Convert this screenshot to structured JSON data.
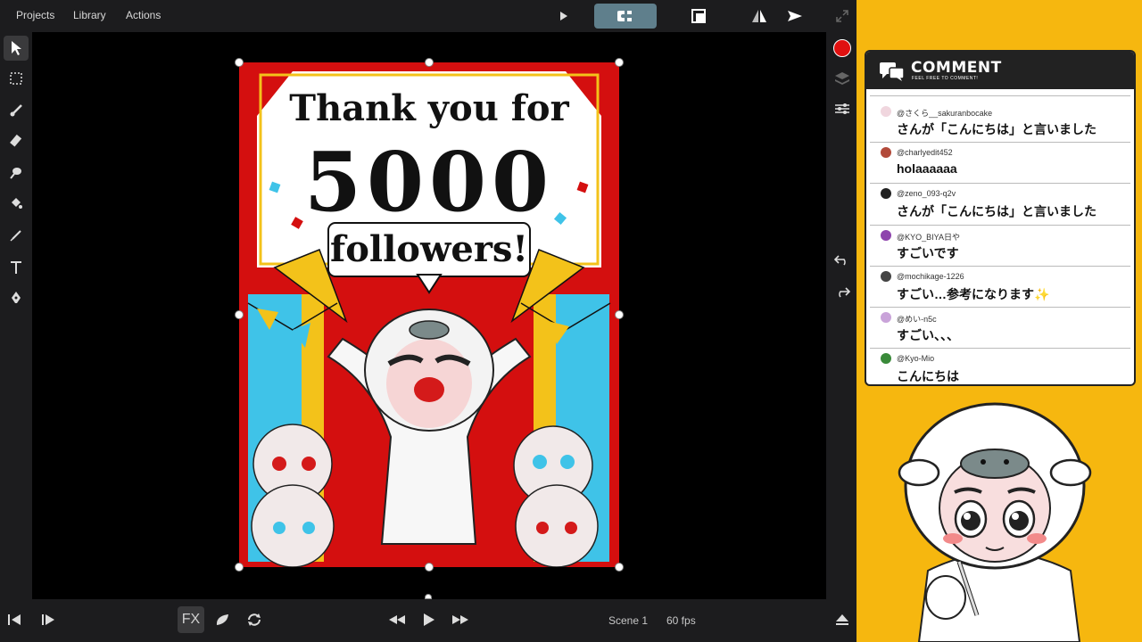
{
  "topbar": {
    "menu": [
      "Projects",
      "Library",
      "Actions"
    ]
  },
  "artwork": {
    "line1": "Thank you for",
    "line2": "5000",
    "line3": "followers!"
  },
  "bottombar": {
    "fx_label": "FX",
    "scene_label": "Scene 1",
    "fps_label": "60 fps"
  },
  "comments": {
    "title": "COMMENT",
    "subtitle": "FEEL FREE TO COMMENT!",
    "items": [
      {
        "user": "@さくら__sakuranbocake",
        "message": "さんが「こんにちは」と言いました",
        "avatar_color": "#f0d6de"
      },
      {
        "user": "@charlyedit452",
        "message": "holaaaaaa",
        "avatar_color": "#b24a3a"
      },
      {
        "user": "@zeno_093-q2v",
        "message": "さんが「こんにちは」と言いました",
        "avatar_color": "#222222"
      },
      {
        "user": "@KYO_BIYA日や",
        "message": "すごいです",
        "avatar_color": "#8e44ad"
      },
      {
        "user": "@mochikage-1226",
        "message": "すごい…参考になります✨",
        "avatar_color": "#444444"
      },
      {
        "user": "@めい-n5c",
        "message": "すごい、、、",
        "avatar_color": "#c9a3d9"
      },
      {
        "user": "@Kyo-Mio",
        "message": "こんにちは",
        "avatar_color": "#3a8a3a"
      }
    ]
  },
  "colors": {
    "accent": "#5f7f8c",
    "record": "#e01010",
    "stream_bg": "#f6b70f",
    "art_red": "#d40f0f",
    "art_blue": "#3fc3e8",
    "art_yellow": "#f3c21a"
  }
}
